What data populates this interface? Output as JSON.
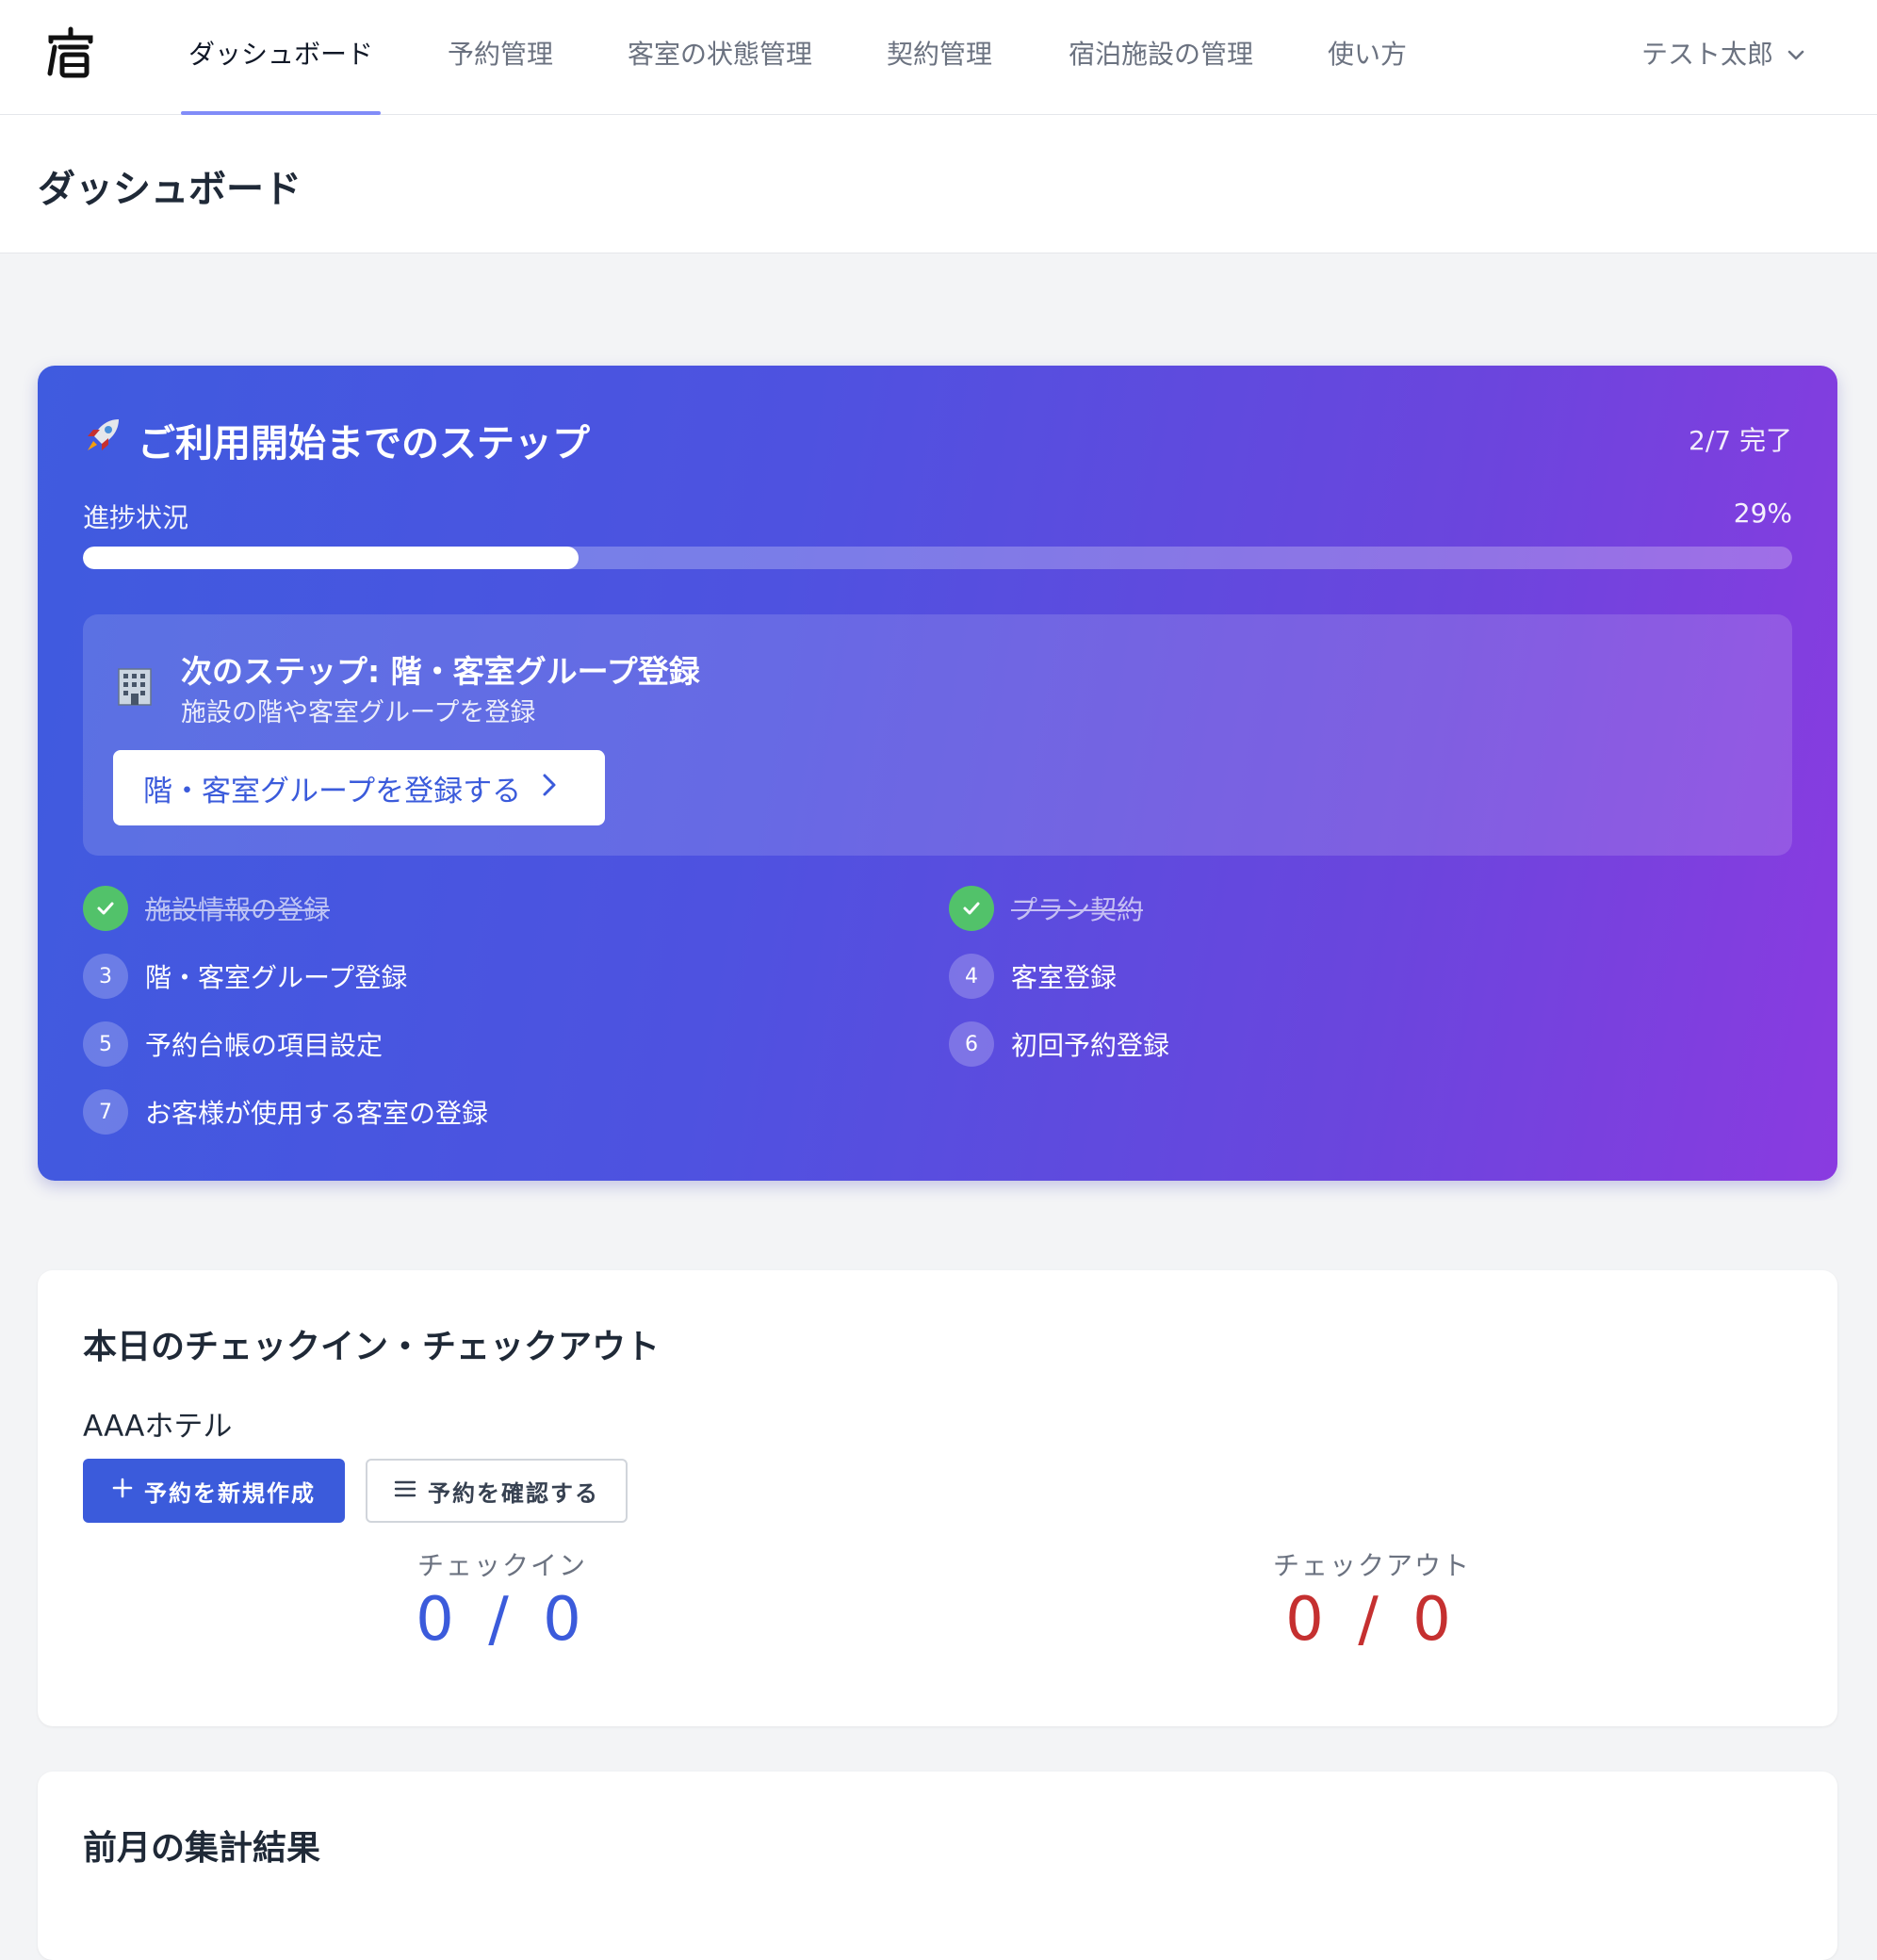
{
  "nav": {
    "logo_text": "宿",
    "items": [
      {
        "label": "ダッシュボード",
        "active": true
      },
      {
        "label": "予約管理"
      },
      {
        "label": "客室の状態管理"
      },
      {
        "label": "契約管理"
      },
      {
        "label": "宿泊施設の管理"
      },
      {
        "label": "使い方"
      }
    ],
    "user_name": "テスト太郎"
  },
  "page": {
    "title": "ダッシュボード"
  },
  "onboarding": {
    "title": "ご利用開始までのステップ",
    "count_text": "2/7 完了",
    "progress_label": "進捗状況",
    "progress_pct_text": "29%",
    "progress_fraction": 0.29,
    "next_step": {
      "title": "次のステップ: 階・客室グループ登録",
      "description": "施設の階や客室グループを登録",
      "button_label": "階・客室グループを登録する"
    },
    "steps": [
      {
        "number": "1",
        "label": "施設情報の登録",
        "done": true
      },
      {
        "number": "2",
        "label": "プラン契約",
        "done": true
      },
      {
        "number": "3",
        "label": "階・客室グループ登録",
        "done": false
      },
      {
        "number": "4",
        "label": "客室登録",
        "done": false
      },
      {
        "number": "5",
        "label": "予約台帳の項目設定",
        "done": false
      },
      {
        "number": "6",
        "label": "初回予約登録",
        "done": false
      },
      {
        "number": "7",
        "label": "お客様が使用する客室の登録",
        "done": false
      }
    ]
  },
  "today": {
    "title": "本日のチェックイン・チェックアウト",
    "hotel_name": "AAAホテル",
    "new_reservation_label": "予約を新規作成",
    "view_reservations_label": "予約を確認する",
    "checkin_label": "チェックイン",
    "checkin_value": "0 / 0",
    "checkout_label": "チェックアウト",
    "checkout_value": "0 / 0",
    "checkin_color": "#3b5bdb",
    "checkout_color": "#c53030"
  },
  "monthly": {
    "title": "前月の集計結果"
  }
}
